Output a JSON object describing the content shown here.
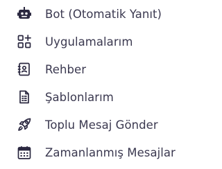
{
  "menu": {
    "items": [
      {
        "label": "Bot (Otomatik Yanıt)",
        "icon": "robot-icon"
      },
      {
        "label": "Uygulamalarım",
        "icon": "apps-add-icon"
      },
      {
        "label": "Rehber",
        "icon": "contact-book-icon"
      },
      {
        "label": "Şablonlarım",
        "icon": "template-document-icon"
      },
      {
        "label": "Toplu Mesaj Gönder",
        "icon": "rocket-icon"
      },
      {
        "label": "Zamanlanmış Mesajlar",
        "icon": "calendar-icon"
      }
    ]
  },
  "colors": {
    "text": "#3b3950",
    "icon": "#2b2840",
    "background": "#ffffff"
  }
}
